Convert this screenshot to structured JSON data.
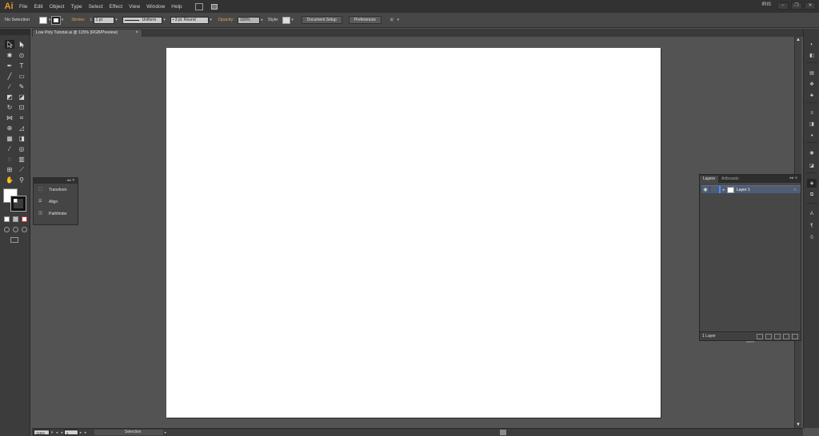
{
  "app": {
    "logo": "Ai"
  },
  "menu": [
    "File",
    "Edit",
    "Object",
    "Type",
    "Select",
    "Effect",
    "View",
    "Window",
    "Help"
  ],
  "workspace": "IRIS",
  "window_controls": [
    "–",
    "❐",
    "✕"
  ],
  "control_bar": {
    "selection_label": "No Selection",
    "stroke_label": "Stroke:",
    "stroke_weight": "1 pt",
    "stroke_profile": "Uniform",
    "brush": "3 pt. Round",
    "opacity_label": "Opacity:",
    "opacity_value": "100%",
    "style_label": "Style:",
    "document_setup": "Document Setup",
    "preferences": "Preferences"
  },
  "document": {
    "tab_title": "Low Poly Tutorial.ai @ 115% (RGB/Preview)",
    "close": "×"
  },
  "float_panel": {
    "items": [
      "Transform",
      "Align",
      "Pathfinder"
    ]
  },
  "layers_panel": {
    "tabs": [
      "Layers",
      "Artboards"
    ],
    "layer_name": "Layer 1",
    "count": "1 Layer"
  },
  "status_bar": {
    "zoom": "115%",
    "artboard_number": "1",
    "current_tool": "Selection"
  },
  "colors": {
    "accent": "#e8952f",
    "layer_color": "#4a8cff",
    "ui_background": "#535353",
    "artboard": "#ffffff"
  }
}
